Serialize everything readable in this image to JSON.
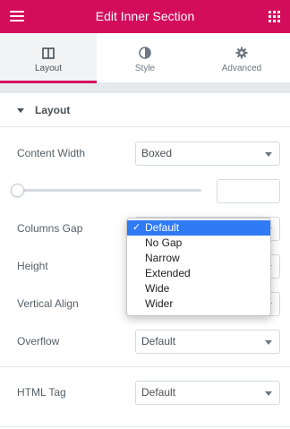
{
  "header": {
    "title": "Edit Inner Section"
  },
  "tabs": [
    {
      "label": "Layout",
      "icon": "layout-columns-icon",
      "active": true
    },
    {
      "label": "Style",
      "icon": "half-circle-icon",
      "active": false
    },
    {
      "label": "Advanced",
      "icon": "gear-icon",
      "active": false
    }
  ],
  "section": {
    "title": "Layout"
  },
  "controls": {
    "content_width": {
      "label": "Content Width",
      "value": "Boxed"
    },
    "columns_gap": {
      "label": "Columns Gap",
      "value": "Default"
    },
    "height": {
      "label": "Height"
    },
    "vertical_align": {
      "label": "Vertical Align"
    },
    "overflow": {
      "label": "Overflow",
      "value": "Default"
    },
    "html_tag": {
      "label": "HTML Tag",
      "value": "Default"
    }
  },
  "dropdown": {
    "check": "✓",
    "options": [
      "Default",
      "No Gap",
      "Narrow",
      "Extended",
      "Wide",
      "Wider"
    ],
    "selected": "Default"
  },
  "colors": {
    "brand": "#d30c5c",
    "selection": "#2f7af5"
  }
}
